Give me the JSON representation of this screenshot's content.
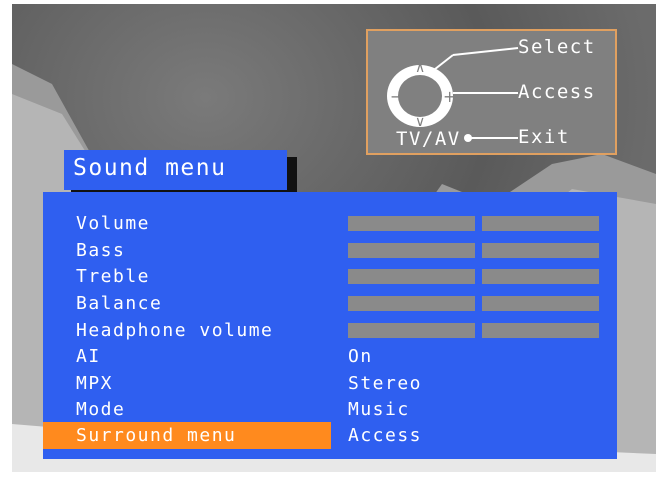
{
  "help": {
    "select_label": "Select",
    "access_label": "Access",
    "exit_label": "Exit",
    "tvav_label": "TV/AV"
  },
  "menu": {
    "title": "Sound menu",
    "items": [
      {
        "label": "Volume",
        "value": "",
        "type": "bar"
      },
      {
        "label": "Bass",
        "value": "",
        "type": "bar"
      },
      {
        "label": "Treble",
        "value": "",
        "type": "bar"
      },
      {
        "label": "Balance",
        "value": "",
        "type": "bar"
      },
      {
        "label": "Headphone volume",
        "value": "",
        "type": "bar"
      },
      {
        "label": "AI",
        "value": "On",
        "type": "text"
      },
      {
        "label": "MPX",
        "value": "Stereo",
        "type": "text"
      },
      {
        "label": "Mode",
        "value": "Music",
        "type": "text"
      },
      {
        "label": "Surround menu",
        "value": "Access",
        "type": "text",
        "selected": true
      }
    ]
  },
  "colors": {
    "panel": "#2f5ff0",
    "highlight": "#ff8a1e",
    "bar": "#8a8a8a",
    "help_border": "#e0a060"
  }
}
